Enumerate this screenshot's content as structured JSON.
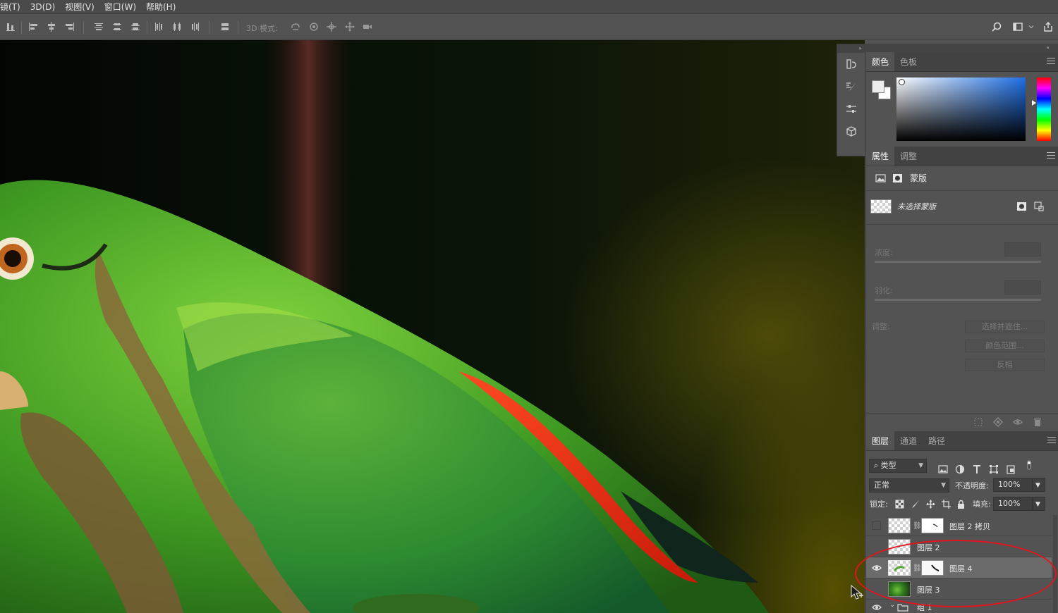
{
  "menubar": {
    "items": [
      "镜(T)",
      "3D(D)",
      "视图(V)",
      "窗口(W)",
      "帮助(H)"
    ]
  },
  "options_bar": {
    "mode3d_label": "3D 模式:",
    "icons": [
      "align-left-edges-icon",
      "align-horizontal-centers-icon",
      "align-right-edges-icon",
      "distribute-top-icon",
      "distribute-vertical-centers-icon",
      "distribute-bottom-icon",
      "distribute-left-icon",
      "distribute-horizontal-centers-icon",
      "distribute-right-icon",
      "auto-align-icon",
      "rotate-3d-icon",
      "roll-3d-icon",
      "drag-3d-icon",
      "slide-3d-icon",
      "scale-3d-icon",
      "search-icon",
      "workspace-icon",
      "share-icon"
    ]
  },
  "icon_strip": {
    "collapse_glyph": "»",
    "icons": [
      "history-icon",
      "brush-settings-icon",
      "adjustments-icon",
      "3d-cube-icon"
    ]
  },
  "color_panel": {
    "tabs": [
      "颜色",
      "色板"
    ],
    "active_tab": "颜色",
    "foreground": "#ededed",
    "background": "#ffffff",
    "hue_color": "#1e6fe6"
  },
  "properties_panel": {
    "tabs": [
      "属性",
      "调整"
    ],
    "active_tab": "属性",
    "type_label": "蒙版",
    "mask_status": "未选择蒙版",
    "density_label": "浓度:",
    "feather_label": "羽化:",
    "refine_label": "调整:",
    "buttons": [
      "选择并遮住...",
      "颜色范围...",
      "反相"
    ]
  },
  "layers_panel": {
    "tabs": [
      "图层",
      "通道",
      "路径"
    ],
    "active_tab": "图层",
    "filter_kind": "类型",
    "blend_mode": "正常",
    "opacity_label": "不透明度:",
    "opacity_value": "100%",
    "lock_label": "锁定:",
    "fill_label": "填充:",
    "fill_value": "100%",
    "layers": [
      {
        "name": "图层 2 拷贝",
        "visible": false,
        "has_mask": true,
        "selected": false
      },
      {
        "name": "图层 2",
        "visible": false,
        "has_mask": false,
        "selected": false
      },
      {
        "name": "图层 4",
        "visible": true,
        "has_mask": true,
        "selected": true
      },
      {
        "name": "图层 3",
        "visible": false,
        "has_mask": false,
        "selected": false
      },
      {
        "name": "组 1",
        "visible": true,
        "is_group": true,
        "selected": false
      }
    ]
  },
  "annotation_color": "#e2141c"
}
